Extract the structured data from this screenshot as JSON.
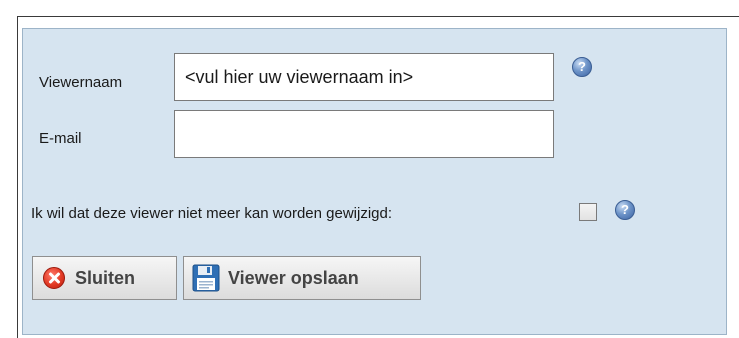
{
  "form": {
    "viewer_name": {
      "label": "Viewernaam",
      "value": "<vul hier uw viewernaam in>"
    },
    "email": {
      "label": "E-mail",
      "value": ""
    },
    "lock_option": {
      "label": "Ik wil dat deze viewer niet meer kan worden gewijzigd:",
      "checked": false
    },
    "help_icon_name": "help-icon"
  },
  "buttons": {
    "close_label": "Sluiten",
    "close_icon": "close-icon",
    "save_label": "Viewer opslaan",
    "save_icon": "save-floppy-icon"
  },
  "colors": {
    "panel_background": "#d6e4f0",
    "panel_border": "#9db4c8",
    "help_icon": "#3b62a3",
    "close_icon": "#e23a25",
    "save_icon": "#2f6fb5"
  }
}
